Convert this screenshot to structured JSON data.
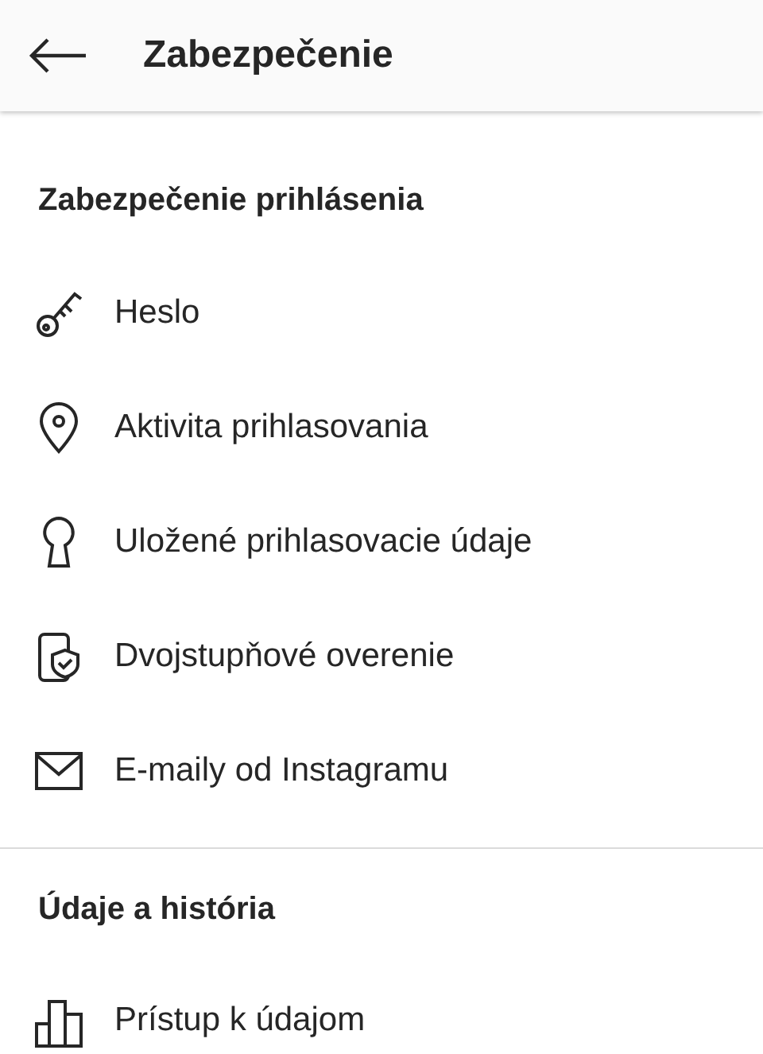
{
  "header": {
    "title": "Zabezpečenie"
  },
  "sections": [
    {
      "title": "Zabezpečenie prihlásenia",
      "items": [
        {
          "kind": "key",
          "label": "Heslo"
        },
        {
          "kind": "pin",
          "label": "Aktivita prihlasovania"
        },
        {
          "kind": "keyhole",
          "label": "Uložené prihlasovacie údaje"
        },
        {
          "kind": "phone-shield",
          "label": "Dvojstupňové overenie"
        },
        {
          "kind": "mail",
          "label": "E-maily od Instagramu"
        }
      ]
    },
    {
      "title": "Údaje a história",
      "items": [
        {
          "kind": "chart",
          "label": "Prístup k údajom"
        }
      ]
    }
  ]
}
